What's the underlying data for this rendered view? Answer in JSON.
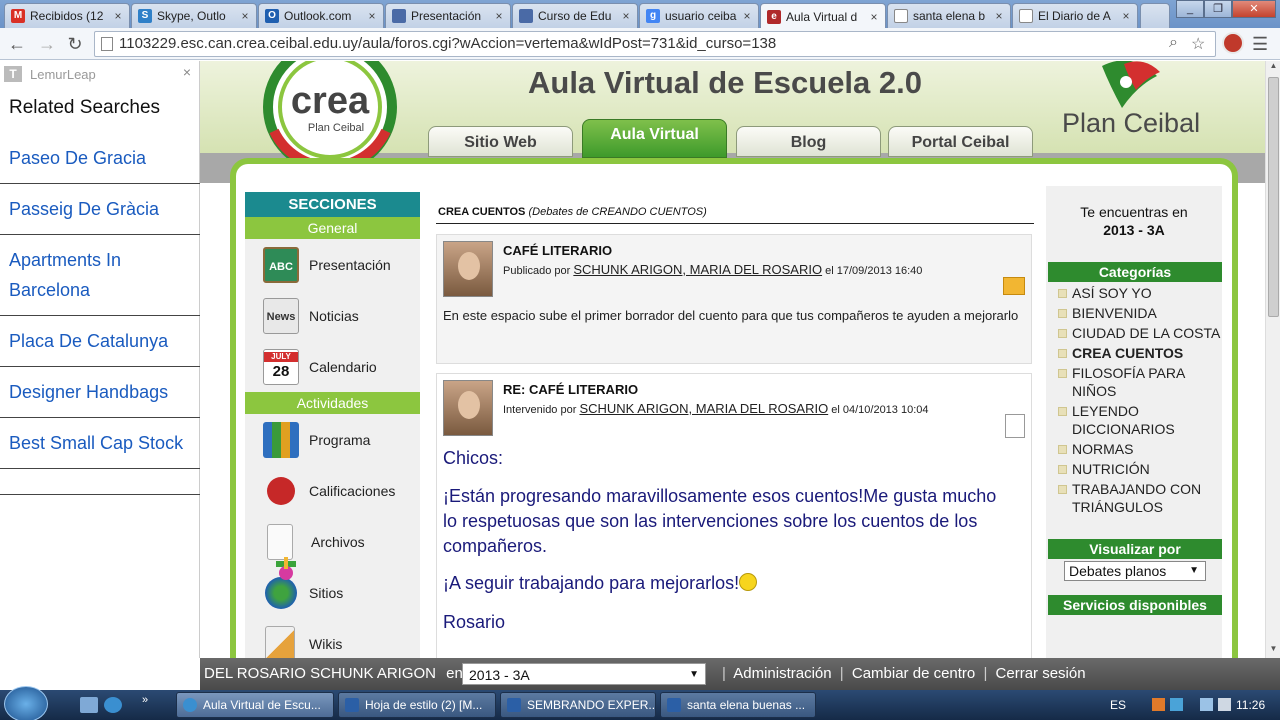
{
  "browser": {
    "tabs": [
      {
        "label": "Recibidos (12",
        "icon": "gmail-icon",
        "color": "#d93025"
      },
      {
        "label": "Skype, Outlo",
        "icon": "skype-icon",
        "color": "#2f80c8"
      },
      {
        "label": "Outlook.com",
        "icon": "outlook-icon",
        "color": "#1f5fb0"
      },
      {
        "label": "Presentación",
        "icon": "page-icon",
        "color": "#4a6aa6"
      },
      {
        "label": "Curso de Edu",
        "icon": "page-icon",
        "color": "#4a6aa6"
      },
      {
        "label": "usuario ceiba",
        "icon": "google-icon",
        "color": "#4285f4"
      },
      {
        "label": "Aula Virtual d",
        "icon": "aula-icon",
        "color": "#b0292a"
      },
      {
        "label": "santa elena b",
        "icon": "doc-icon",
        "color": "#888888"
      },
      {
        "label": "El Diario de A",
        "icon": "doc-icon",
        "color": "#888888"
      }
    ],
    "url": "1103229.esc.can.crea.ceibal.edu.uy/aula/foros.cgi?wAccion=vertema&wIdPost=731&id_curso=138"
  },
  "lemur": {
    "brand": "LemurLeap",
    "title": "Related Searches",
    "items": [
      "Paseo De Gracia",
      "Passeig De Gràcia",
      "Apartments In Barcelona",
      "Placa De Catalunya",
      "Designer Handbags",
      "Best Small Cap Stock"
    ]
  },
  "header": {
    "logo_text": "crea",
    "logo_sub": "Plan Ceibal",
    "title": "Aula Virtual de Escuela 2.0",
    "tabs": [
      "Sitio Web",
      "Aula Virtual",
      "Blog",
      "Portal Ceibal"
    ],
    "brand": "Plan Ceibal"
  },
  "leftnav": {
    "heading": "SECCIONES",
    "general": "General",
    "general_items": [
      "Presentación",
      "Noticias",
      "Calendario"
    ],
    "actividades": "Actividades",
    "actividades_items": [
      "Programa",
      "Calificaciones",
      "Archivos",
      "Sitios",
      "Wikis"
    ],
    "icon_labels": {
      "presentacion": "ABC",
      "noticias": "News",
      "calendario_month": "JULY",
      "calendario_day": "28"
    }
  },
  "main": {
    "crumb_title": "CREA CUENTOS",
    "crumb_sub": "(Debates de CREANDO CUENTOS)",
    "posts": [
      {
        "title": "CAFÉ LITERARIO",
        "meta_prefix": "Publicado por",
        "author": "SCHUNK ARIGON, MARIA DEL ROSARIO",
        "meta_suffix": "el 17/09/2013 16:40",
        "body": "En este espacio sube el primer borrador del cuento para que tus compañeros te ayuden a mejorarlo"
      },
      {
        "title": "RE: CAFÉ LITERARIO",
        "meta_prefix": "Intervenido por",
        "author": "SCHUNK ARIGON, MARIA DEL ROSARIO",
        "meta_suffix": "el 04/10/2013 10:04",
        "p1": "Chicos:",
        "p2": "¡Están progresando maravillosamente esos cuentos!Me gusta mucho lo respetuosas que son las intervenciones sobre los cuentos de los compañeros.",
        "p3": "¡A seguir trabajando para mejorarlos!",
        "p4": "Rosario"
      }
    ]
  },
  "rightcol": {
    "loc_label": "Te encuentras en",
    "loc_value": "2013 - 3A",
    "categories_title": "Categorías",
    "categories": [
      "ASÍ SOY YO",
      "BIENVENIDA",
      "CIUDAD DE LA COSTA",
      "CREA CUENTOS",
      "FILOSOFÍA PARA NIÑOS",
      "LEYENDO DICCIONARIOS",
      "NORMAS",
      "NUTRICIÓN",
      "TRABAJANDO CON TRIÁNGULOS"
    ],
    "active_category": "CREA CUENTOS",
    "view_title": "Visualizar por",
    "view_selected": "Debates planos",
    "services_title": "Servicios disponibles"
  },
  "userbar": {
    "name": "DEL ROSARIO SCHUNK ARIGON",
    "en": "en",
    "selected": "2013 - 3A",
    "links": [
      "Administración",
      "Cambiar de centro",
      "Cerrar sesión"
    ]
  },
  "taskbar": {
    "items": [
      {
        "label": "Aula Virtual de Escu...",
        "color": "#3a8fd0"
      },
      {
        "label": "Hoja de estilo (2) [M...",
        "color": "#2b5fa6"
      },
      {
        "label": "SEMBRANDO EXPER...",
        "color": "#2b5fa6"
      },
      {
        "label": "santa elena buenas ...",
        "color": "#2b5fa6"
      }
    ],
    "lang": "ES",
    "time": "11:26"
  },
  "colors": {
    "green_accent": "#8cc63f",
    "teal_heading": "#1b8a8f",
    "link_blue": "#1a5bbf"
  }
}
